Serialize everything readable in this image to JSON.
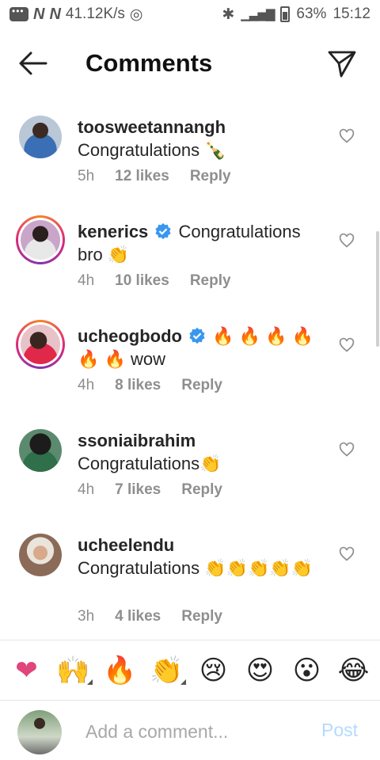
{
  "status_bar": {
    "speed": "41.12K/s",
    "battery": "63%",
    "time": "15:12"
  },
  "header": {
    "title": "Comments",
    "back_icon": "arrow-left-icon",
    "send_icon": "paper-plane-icon"
  },
  "comments": [
    {
      "username": "toosweetannangh",
      "verified": false,
      "text": "Congratulations 🍾",
      "time": "5h",
      "likes": "12 likes",
      "reply": "Reply"
    },
    {
      "username": "kenerics",
      "verified": true,
      "text": "Congratulations bro 👏",
      "time": "4h",
      "likes": "10 likes",
      "reply": "Reply"
    },
    {
      "username": "ucheogbodo",
      "verified": true,
      "text": "🔥 🔥 🔥 🔥 🔥 🔥 wow",
      "time": "4h",
      "likes": "8 likes",
      "reply": "Reply"
    },
    {
      "username": "ssoniaibrahim",
      "verified": false,
      "text": "Congratulations👏",
      "time": "4h",
      "likes": "7 likes",
      "reply": "Reply"
    },
    {
      "username": "ucheelendu",
      "verified": false,
      "text": "Congratulations 👏👏👏👏👏",
      "time": "3h",
      "likes": "4 likes",
      "reply": "Reply"
    }
  ],
  "emoji_bar": [
    "❤",
    "🙌",
    "🔥",
    "👏",
    "😢",
    "😍",
    "😮",
    "😂"
  ],
  "compose": {
    "placeholder": "Add a comment...",
    "post_label": "Post"
  },
  "colors": {
    "verified_blue": "#3897f0",
    "post_disabled": "#b3dbff",
    "story_ring": "#dd2a7b"
  }
}
